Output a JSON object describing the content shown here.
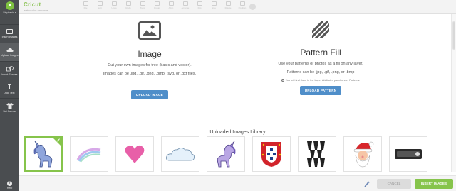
{
  "sidebar": {
    "profile_name": "Stephanie ▾",
    "items": [
      {
        "label": "Insert Images",
        "icon": "image-icon"
      },
      {
        "label": "Upload Images",
        "icon": "upload-cloud-icon"
      },
      {
        "label": "Insert Shapes",
        "icon": "shapes-icon"
      },
      {
        "label": "Add Text",
        "icon": "text-icon"
      },
      {
        "label": "Set Canvas",
        "icon": "shirt-icon"
      }
    ],
    "help_label": "Help"
  },
  "topbar": {
    "brand": "Cricut",
    "project": "watercolor unicorns",
    "tools": [
      "File",
      "Edit",
      "Undo",
      "Redo",
      "Sync",
      "Group",
      "Align",
      "Arrange",
      "Flip",
      "Size",
      "Rotate",
      "Position",
      ""
    ]
  },
  "image_panel": {
    "title": "Image",
    "desc1": "Cut your own images for free (basic and vector).",
    "desc2": "Images can be .jpg, .gif, .png, .bmp, .svg, or .dxf files.",
    "button": "UPLOAD IMAGE"
  },
  "pattern_panel": {
    "title": "Pattern Fill",
    "desc1": "Use your patterns or photos as a fill on any layer.",
    "desc2": "Patterns can be .jpg, .gif, .png, or .bmp",
    "note": "You will find them in the Layer Attributes panel under Patterns.",
    "button": "UPLOAD PATTERN"
  },
  "library": {
    "title": "Uploaded Images Library",
    "thumbs": [
      {
        "name": "unicorn-blue",
        "selected": true
      },
      {
        "name": "rainbow",
        "selected": false
      },
      {
        "name": "heart",
        "selected": false
      },
      {
        "name": "cloud",
        "selected": false
      },
      {
        "name": "unicorn-purple",
        "selected": false
      },
      {
        "name": "portugal-crest",
        "selected": false
      },
      {
        "name": "feather-pattern",
        "selected": false
      },
      {
        "name": "santa",
        "selected": false
      },
      {
        "name": "label-tag",
        "selected": false
      }
    ]
  },
  "bottombar": {
    "cancel": "CANCEL",
    "insert": "INSERT IMAGES"
  },
  "colors": {
    "accent_green": "#86c44b",
    "button_blue": "#4f8ec9",
    "sidebar_dark": "#4a4d50"
  }
}
